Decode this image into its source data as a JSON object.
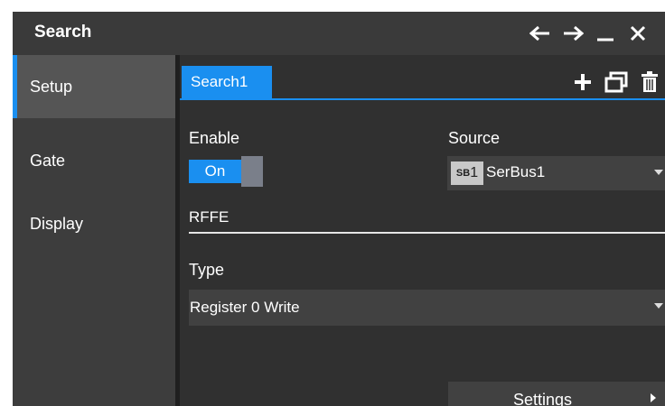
{
  "window": {
    "title": "Search"
  },
  "titlebar_icons": [
    "arrow-left-icon",
    "arrow-right-icon",
    "minimize-icon",
    "close-icon"
  ],
  "sidebar": {
    "items": [
      {
        "label": "Setup",
        "active": true
      },
      {
        "label": "Gate"
      },
      {
        "label": "Display"
      }
    ]
  },
  "tabs": [
    {
      "label": "Search1",
      "active": true
    }
  ],
  "tab_actions": [
    "plus-icon",
    "duplicate-icon",
    "trash-icon"
  ],
  "enable": {
    "label": "Enable",
    "state": "On"
  },
  "source": {
    "label": "Source",
    "badge_prefix": "SB",
    "badge_num": "1",
    "value": "SerBus1"
  },
  "section": {
    "label": "RFFE"
  },
  "type": {
    "label": "Type",
    "value": "Register 0 Write"
  },
  "settings": {
    "label": "Settings"
  },
  "colors": {
    "accent": "#1a8ff0",
    "background": "#2b2b2b",
    "titlebar": "#3a3a3a"
  }
}
